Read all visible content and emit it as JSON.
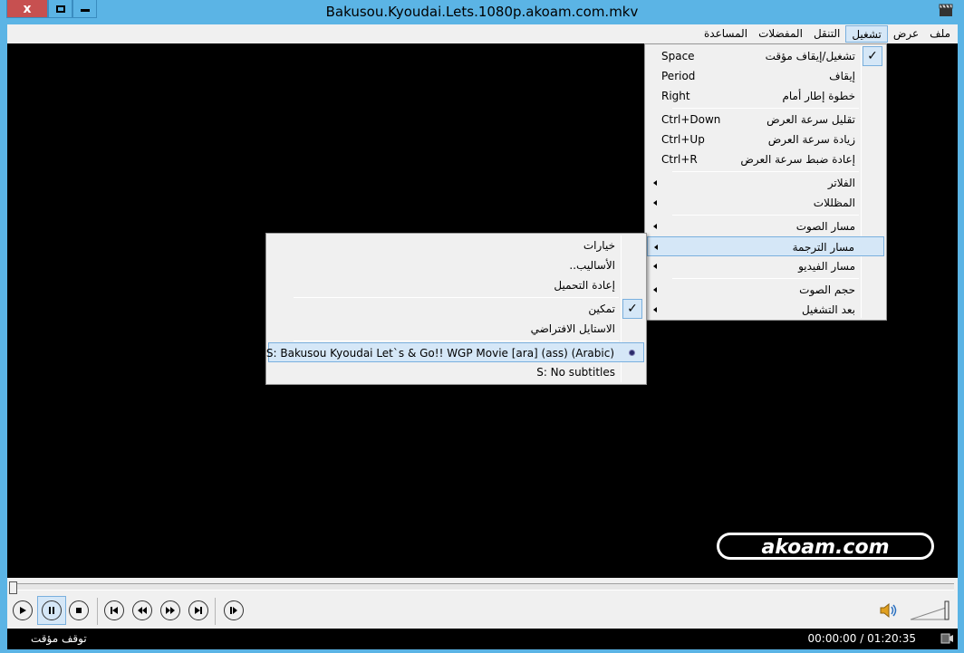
{
  "window": {
    "title": "Bakusou.Kyoudai.Lets.1080p.akoam.com.mkv",
    "close_glyph": "x"
  },
  "menubar": {
    "items": [
      {
        "label": "ملف",
        "active": false
      },
      {
        "label": "عرض",
        "active": false
      },
      {
        "label": "تشغيل",
        "active": true
      },
      {
        "label": "التنقل",
        "active": false
      },
      {
        "label": "المفضلات",
        "active": false
      },
      {
        "label": "المساعدة",
        "active": false
      }
    ]
  },
  "play_menu": {
    "items": [
      {
        "label": "تشغيل/إيقاف مؤقت",
        "shortcut": "Space",
        "checked": true
      },
      {
        "label": "إيقاف",
        "shortcut": "Period"
      },
      {
        "label": "خطوة إطار أمام",
        "shortcut": "Right"
      },
      {
        "label": "تقليل سرعة العرض",
        "shortcut": "Ctrl+Down"
      },
      {
        "label": "زيادة سرعة العرض",
        "shortcut": "Ctrl+Up"
      },
      {
        "label": "إعادة ضبط سرعة العرض",
        "shortcut": "Ctrl+R"
      },
      {
        "label": "الفلاتر",
        "submenu": true
      },
      {
        "label": "المظللات",
        "submenu": true
      },
      {
        "label": "مسار الصوت",
        "submenu": true
      },
      {
        "label": "مسار الترجمة",
        "submenu": true,
        "highlighted": true
      },
      {
        "label": "مسار الفيديو",
        "submenu": true
      },
      {
        "label": "حجم الصوت",
        "submenu": true
      },
      {
        "label": "بعد التشغيل",
        "submenu": true
      }
    ]
  },
  "subtitle_menu": {
    "items": [
      {
        "label": "خيارات"
      },
      {
        "label": "الأساليب.."
      },
      {
        "label": "إعادة التحميل"
      },
      {
        "label": "تمكين",
        "checked": true
      },
      {
        "label": "الاستايل الافتراضي"
      },
      {
        "label": "S: Bakusou Kyoudai Let`s & Go!! WGP Movie [ara] (ass) (Arabic)",
        "selected": true
      },
      {
        "label": "S: No subtitles"
      }
    ]
  },
  "video": {
    "watermark": "akoam.com"
  },
  "statusbar": {
    "state": "توقف مؤقت",
    "time": "00:00:00 / 01:20:35"
  },
  "icons": {
    "check": "✓"
  }
}
